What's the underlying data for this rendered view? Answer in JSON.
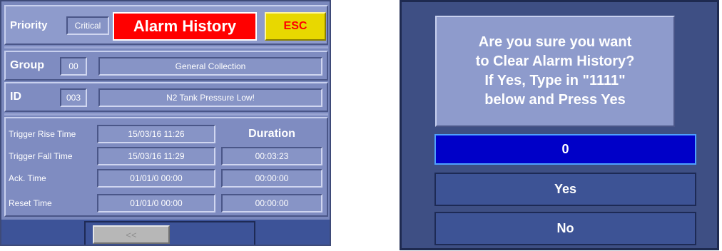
{
  "alarm_history": {
    "priority_label": "Priority",
    "priority_value": "Critical",
    "title": "Alarm History",
    "esc_label": "ESC",
    "group_label": "Group",
    "group_code": "00",
    "group_name": "General Collection",
    "id_label": "ID",
    "id_code": "003",
    "id_name": "N2 Tank Pressure Low!",
    "duration_header": "Duration",
    "rows": [
      {
        "label": "Trigger Rise Time",
        "time": "15/03/16  11:26"
      },
      {
        "label": "Trigger Fall Time",
        "time": "15/03/16  11:29",
        "duration": "00:03:23"
      },
      {
        "label": "Ack. Time",
        "time": "01/01/0  00:00",
        "duration": "00:00:00"
      },
      {
        "label": "Reset Time",
        "time": "01/01/0  00:00",
        "duration": "00:00:00"
      }
    ],
    "prev_label": "<<"
  },
  "confirm_dialog": {
    "message_lines": [
      "Are you sure you want",
      "to Clear Alarm History?",
      "If Yes, Type in \"1111\"",
      "below and Press Yes"
    ],
    "input_value": "0",
    "yes_label": "Yes",
    "no_label": "No"
  },
  "colors": {
    "title_bg": "#ff0000",
    "esc_bg": "#e8d800",
    "esc_text": "#ff0000",
    "input_bg": "#0000c8"
  }
}
